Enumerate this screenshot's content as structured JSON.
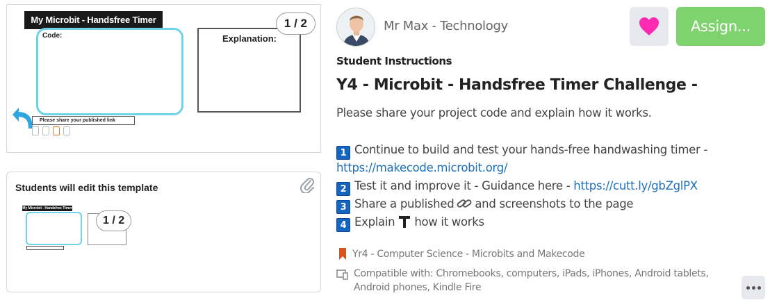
{
  "preview": {
    "page_counter": "1 / 2",
    "doc_title": "My Microbit - Handsfree Timer",
    "code_label": "Code:",
    "explanation_label": "Explanation:",
    "publish_link_text": "Please share your published link"
  },
  "template": {
    "title": "Students will edit this template",
    "thumb_title": "My Microbit - Handsfree Timer",
    "page_counter": "1 / 2"
  },
  "author": "Mr Max - Technology",
  "buttons": {
    "assign": "Assign..."
  },
  "section_label": "Student Instructions",
  "activity_title": "Y4 - Microbit - Handsfree Timer Challenge -",
  "intro": "Please share your project code and explain how it works.",
  "steps": [
    {
      "num": "1",
      "text": "Continue to build and test your hands-free handwashing timer -",
      "link": "https://makecode.microbit.org/"
    },
    {
      "num": "2",
      "text": "Test it and improve it - Guidance here - ",
      "link": "https://cutt.ly/gbZglPX"
    },
    {
      "num": "3",
      "text_before": "Share a published",
      "text_after": "and screenshots to the page"
    },
    {
      "num": "4",
      "text_before": "Explain",
      "text_after": "how it works"
    }
  ],
  "course": "Yr4 - Computer Science - Microbits and Makecode",
  "compatibility": "Compatible with: Chromebooks, computers, iPads, iPhones, Android tablets, Android phones, Kindle Fire",
  "colors": {
    "assign_green": "#7ed36f",
    "heart_pink": "#ff2bb0",
    "badge_blue": "#1565c0",
    "link_blue": "#1d6fb8",
    "bookmark_orange": "#d9531e"
  }
}
